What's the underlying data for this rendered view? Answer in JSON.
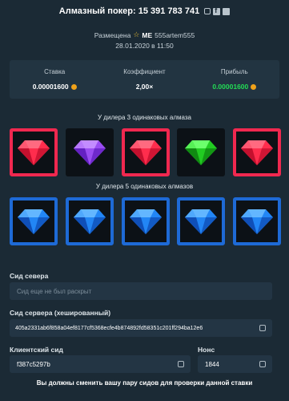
{
  "header": {
    "title": "Алмазный покер: 15 391 783 741",
    "placed_by_prefix": "Размещена",
    "badge": "ME",
    "username": "555artem555",
    "date": "28.01.2020 в 11:50"
  },
  "stats": [
    {
      "label": "Ставка",
      "value": "0.00001600",
      "has_coin": true,
      "color": "#ffffff"
    },
    {
      "label": "Коэффициент",
      "value": "2,00×",
      "has_coin": false,
      "color": "#ffffff"
    },
    {
      "label": "Прибыль",
      "value": "0.00001600",
      "has_coin": true,
      "color": "#22dd55"
    }
  ],
  "dealer": {
    "label": "У дилера 3 одинаковых алмаза",
    "gems": [
      {
        "color": "red",
        "highlighted": true
      },
      {
        "color": "purple",
        "highlighted": false
      },
      {
        "color": "red",
        "highlighted": true
      },
      {
        "color": "green",
        "highlighted": false
      },
      {
        "color": "red",
        "highlighted": true
      }
    ]
  },
  "player": {
    "label": "У дилера 5 одинаковых алмазов",
    "gems": [
      {
        "color": "blue",
        "highlighted": true
      },
      {
        "color": "blue",
        "highlighted": true
      },
      {
        "color": "blue",
        "highlighted": true
      },
      {
        "color": "blue",
        "highlighted": true
      },
      {
        "color": "blue",
        "highlighted": true
      }
    ]
  },
  "gem_colors": {
    "red": {
      "top": "#ff6a80",
      "mid": "#ff2d4d",
      "dark": "#c4102e"
    },
    "purple": {
      "top": "#c38cff",
      "mid": "#9a4df2",
      "dark": "#6421c2"
    },
    "green": {
      "top": "#6cff6c",
      "mid": "#22cc22",
      "dark": "#108a12"
    },
    "blue": {
      "top": "#63b6ff",
      "mid": "#2286f5",
      "dark": "#0f4fb8"
    }
  },
  "fairness": {
    "server_seed_label": "Сид севера",
    "server_seed_placeholder": "Сид еще не был раскрыт",
    "hashed_label": "Сид сервера (хешированный)",
    "hashed_value": "405a2331ab6f858a04ef8177cf5368ecfe4b874892fd58351c201ff294ba12e6",
    "client_seed_label": "Клиентский сид",
    "client_seed_value": "f387c5297b",
    "nonce_label": "Нонс",
    "nonce_value": "1844",
    "warning": "Вы должны сменить вашу пару сидов для проверки данной ставки"
  }
}
